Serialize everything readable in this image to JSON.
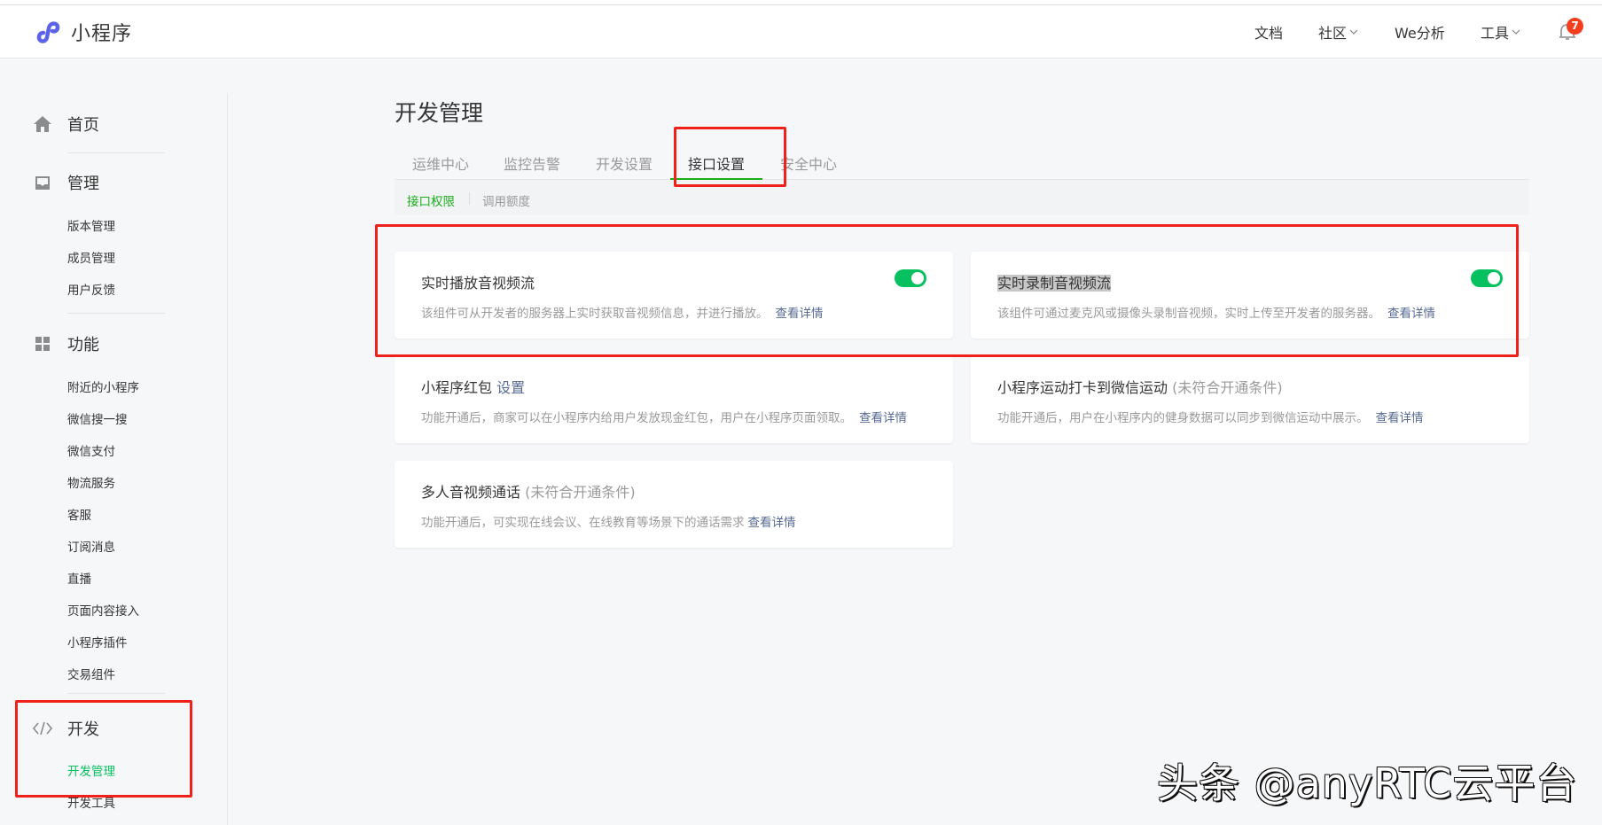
{
  "header": {
    "app_title": "小程序",
    "nav": [
      {
        "label": "文档",
        "has_dropdown": false
      },
      {
        "label": "社区",
        "has_dropdown": true
      },
      {
        "label": "We分析",
        "has_dropdown": false
      },
      {
        "label": "工具",
        "has_dropdown": true
      }
    ],
    "notification_count": "7"
  },
  "sidebar": {
    "home": {
      "label": "首页",
      "icon": "home-icon"
    },
    "manage": {
      "label": "管理",
      "icon": "inbox-icon",
      "items": [
        "版本管理",
        "成员管理",
        "用户反馈"
      ]
    },
    "features": {
      "label": "功能",
      "icon": "grid-icon",
      "items": [
        "附近的小程序",
        "微信搜一搜",
        "微信支付",
        "物流服务",
        "客服",
        "订阅消息",
        "直播",
        "页面内容接入",
        "小程序插件",
        "交易组件"
      ]
    },
    "develop": {
      "label": "开发",
      "icon": "code-icon",
      "items": [
        "开发管理",
        "开发工具"
      ],
      "active_item": "开发管理"
    }
  },
  "main": {
    "title": "开发管理",
    "tabs": [
      "运维中心",
      "监控告警",
      "开发设置",
      "接口设置",
      "安全中心"
    ],
    "active_tab": "接口设置",
    "subtabs": [
      "接口权限",
      "调用额度"
    ],
    "active_subtab": "接口权限",
    "cards": [
      {
        "title": "实时播放音视频流",
        "description": "该组件可从开发者的服务器上实时获取音视频信息，并进行播放。",
        "link": "查看详情",
        "toggle_on": true
      },
      {
        "title": "实时录制音视频流",
        "description": "该组件可通过麦克风或摄像头录制音视频，实时上传至开发者的服务器。",
        "link": "查看详情",
        "toggle_on": true
      },
      {
        "title": "小程序红包",
        "title_link": "设置",
        "description": "功能开通后，商家可以在小程序内给用户发放现金红包，用户在小程序页面领取。",
        "link": "查看详情"
      },
      {
        "title": "小程序运动打卡到微信运动",
        "title_note": "(未符合开通条件)",
        "description": "功能开通后，用户在小程序内的健身数据可以同步到微信运动中展示。",
        "link": "查看详情"
      },
      {
        "title": "多人音视频通话",
        "title_note": "(未符合开通条件)",
        "description": "功能开通后，可实现在线会议、在线教育等场景下的通话需求",
        "link": "查看详情"
      }
    ]
  },
  "watermark": "头条 @anyRTC云平台",
  "colors": {
    "accent_green": "#07c160",
    "tab_green": "#1aad19",
    "link_blue": "#576b95",
    "badge_red": "#f43f1f",
    "annotation_red": "#f0211b"
  }
}
